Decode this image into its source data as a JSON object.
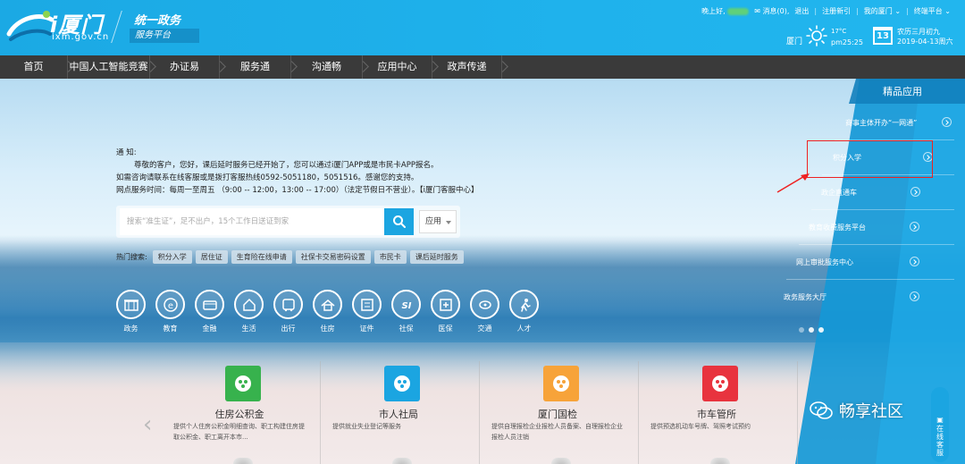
{
  "header": {
    "logo_text": "i厦门",
    "domain": "ixm.gov.cn",
    "slogan_line1": "统一政务",
    "slogan_line2": "服务平台",
    "greeting": "晚上好,",
    "messages": "消息(0),",
    "logout": "退出",
    "register": "注册新引",
    "my_xiamen": "我的厦门",
    "terminal": "终端平台",
    "weather_city": "厦门",
    "weather_temp": "17°C",
    "weather_pm": "pm25:25",
    "calendar_day": "13",
    "lunar_date": "农历三月初九",
    "solar_date": "2019-04-13周六"
  },
  "nav": [
    {
      "label": "首页",
      "width": 76
    },
    {
      "label": "中国人工智能竞赛",
      "width": 92
    },
    {
      "label": "办证易",
      "width": 78
    },
    {
      "label": "服务通",
      "width": 80
    },
    {
      "label": "沟通畅",
      "width": 80
    },
    {
      "label": "应用中心",
      "width": 78
    },
    {
      "label": "政声传递",
      "width": 78
    }
  ],
  "notice": {
    "title": "通 知:",
    "line1": "尊敬的客户，您好，课后延时服务已经开始了，您可以通过i厦门APP或是市民卡APP报名。",
    "line2": "如需咨询请联系在线客服或是拨打客服热线0592-5051180，5051516。感谢您的支持。",
    "line3": "网点服务时间：每周一至周五 （9:00 -- 12:00，13:00 -- 17:00）（法定节假日不营业）。【i厦门客服中心】"
  },
  "search": {
    "placeholder": "搜索“准生证”，足不出户，15个工作日送证到家",
    "select_label": "应用"
  },
  "hot": {
    "label": "热门搜索:",
    "tags": [
      "积分入学",
      "居住证",
      "生育险在线申请",
      "社保卡交易密码设置",
      "市民卡",
      "课后延时服务"
    ]
  },
  "circles": [
    {
      "label": "政务",
      "icon": "building-icon"
    },
    {
      "label": "教育",
      "icon": "e-icon"
    },
    {
      "label": "金融",
      "icon": "wallet-icon"
    },
    {
      "label": "生活",
      "icon": "home-icon"
    },
    {
      "label": "出行",
      "icon": "bus-icon"
    },
    {
      "label": "住房",
      "icon": "house-icon"
    },
    {
      "label": "证件",
      "icon": "card-icon"
    },
    {
      "label": "社保",
      "icon": "si-icon"
    },
    {
      "label": "医保",
      "icon": "medical-icon"
    },
    {
      "label": "交通",
      "icon": "car-icon"
    },
    {
      "label": "人才",
      "icon": "person-icon"
    }
  ],
  "side": {
    "title": "精品应用",
    "items": [
      "商事主体开办“一网通”",
      "积分入学",
      "政企直通车",
      "教育收费服务平台",
      "网上审批服务中心",
      "政务服务大厅"
    ]
  },
  "cards": [
    {
      "title": "住房公积金",
      "desc": "提供个人住房公积金明细查询、职工构建住房提取公积金、职工离开本市...",
      "color": "#37b24d",
      "icon": "fund-icon"
    },
    {
      "title": "市人社局",
      "desc": "提供就业失业登记等服务",
      "color": "#1ba5e1",
      "icon": "social-icon"
    },
    {
      "title": "厦门国检",
      "desc": "提供自理报检企业报检人员备案、自理报检企业报检人员注销",
      "color": "#f7a339",
      "icon": "inspection-icon"
    },
    {
      "title": "市车管所",
      "desc": "提供预选机动车号牌、驾照考试预约",
      "color": "#e8333e",
      "icon": "vehicle-icon"
    }
  ],
  "watermark": "畅享社区",
  "chat_label": "在线客服",
  "colors": {
    "primary": "#1ba5e1",
    "nav_bg": "#3a3a3a",
    "highlight": "#e22222"
  }
}
